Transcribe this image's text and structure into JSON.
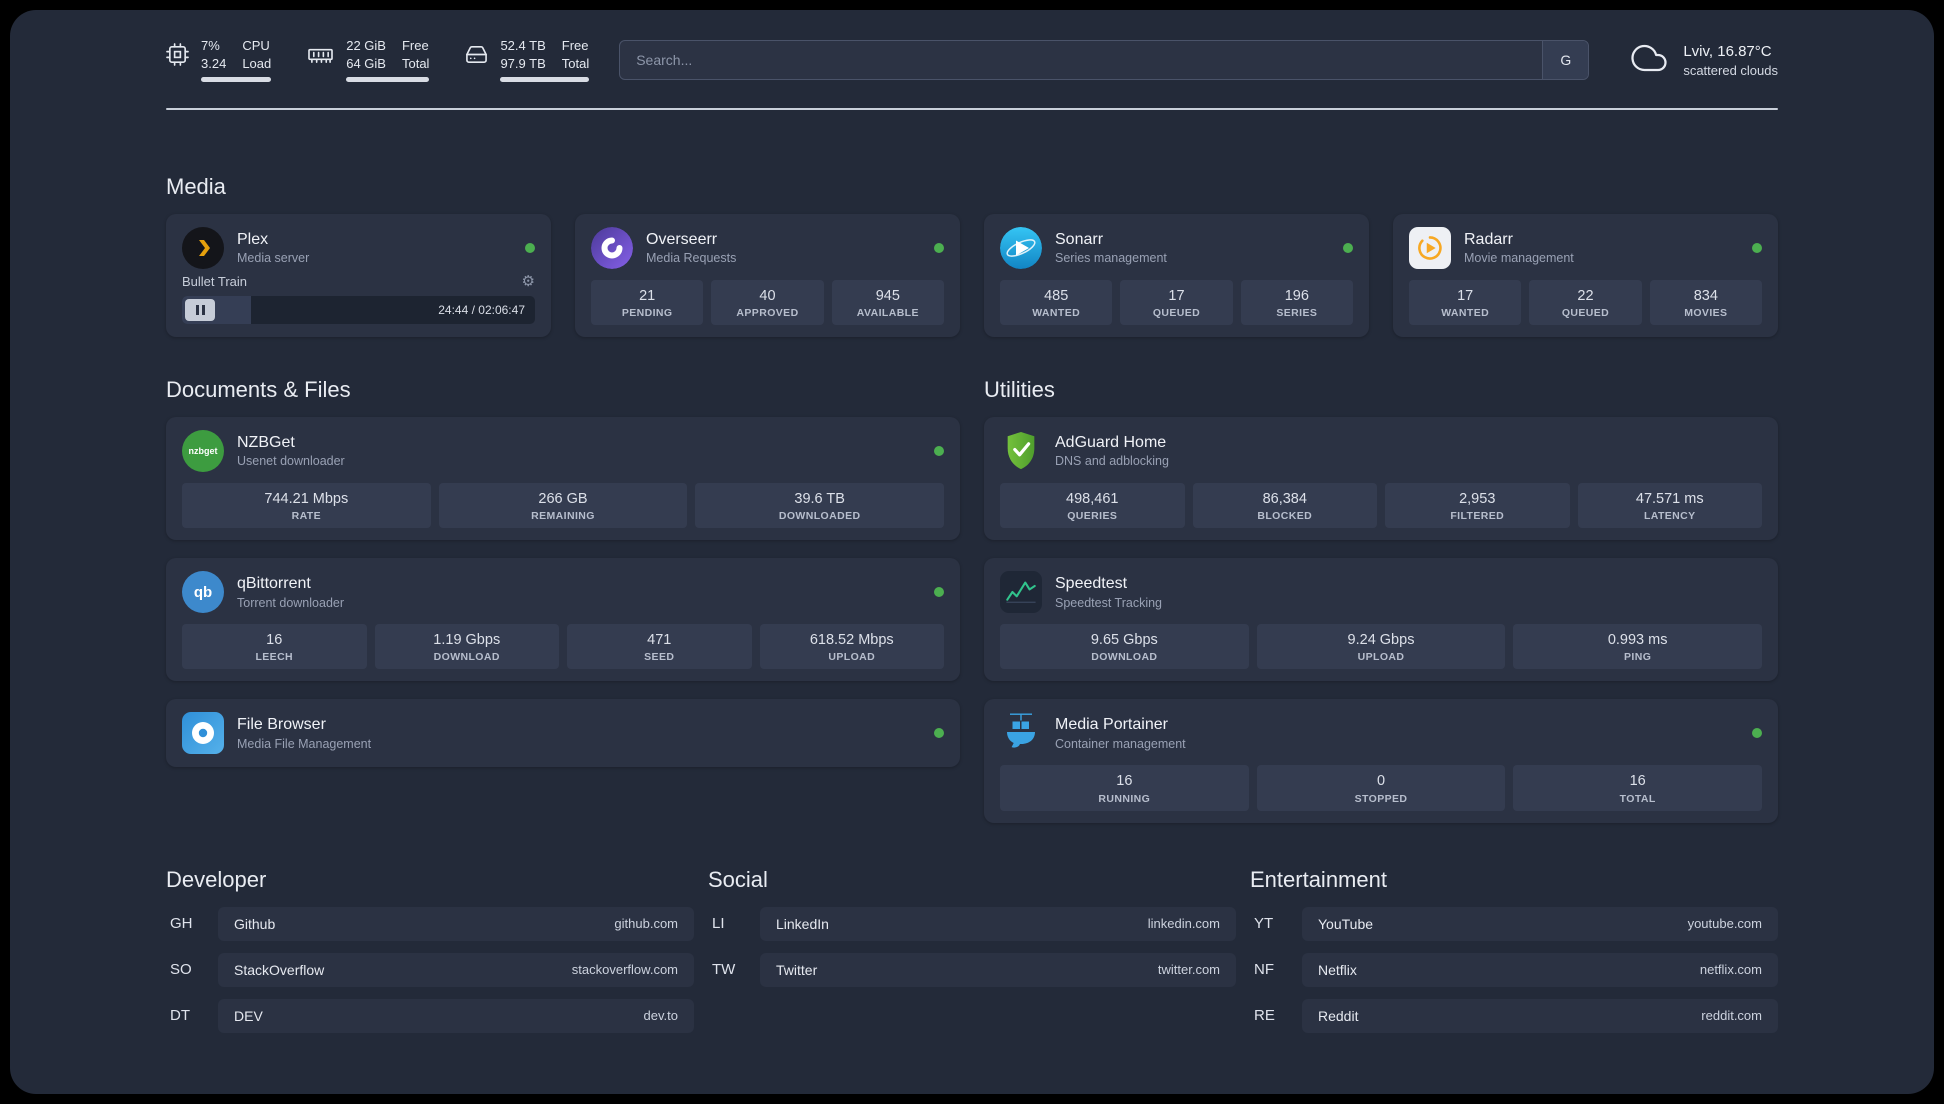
{
  "topbar": {
    "metrics": [
      {
        "icon": "cpu-icon",
        "values": [
          "7%",
          "3.24"
        ],
        "labels": [
          "CPU",
          "Load"
        ]
      },
      {
        "icon": "ram-icon",
        "values": [
          "22 GiB",
          "64 GiB"
        ],
        "labels": [
          "Free",
          "Total"
        ]
      },
      {
        "icon": "disk-icon",
        "values": [
          "52.4 TB",
          "97.9 TB"
        ],
        "labels": [
          "Free",
          "Total"
        ]
      }
    ],
    "search": {
      "placeholder": "Search...",
      "engine_label": "G"
    },
    "weather": {
      "location": "Lviv, 16.87°C",
      "condition": "scattered clouds"
    }
  },
  "media": {
    "title": "Media",
    "cards": [
      {
        "name": "Plex",
        "subtitle": "Media server",
        "online": true,
        "player": {
          "track": "Bullet Train",
          "time": "24:44 / 02:06:47",
          "progress_percent": 19.5
        }
      },
      {
        "name": "Overseerr",
        "subtitle": "Media Requests",
        "online": true,
        "stats": [
          {
            "value": "21",
            "label": "PENDING"
          },
          {
            "value": "40",
            "label": "APPROVED"
          },
          {
            "value": "945",
            "label": "AVAILABLE"
          }
        ]
      },
      {
        "name": "Sonarr",
        "subtitle": "Series management",
        "online": true,
        "stats": [
          {
            "value": "485",
            "label": "WANTED"
          },
          {
            "value": "17",
            "label": "QUEUED"
          },
          {
            "value": "196",
            "label": "SERIES"
          }
        ]
      },
      {
        "name": "Radarr",
        "subtitle": "Movie management",
        "online": true,
        "stats": [
          {
            "value": "17",
            "label": "WANTED"
          },
          {
            "value": "22",
            "label": "QUEUED"
          },
          {
            "value": "834",
            "label": "MOVIES"
          }
        ]
      }
    ]
  },
  "documents": {
    "title": "Documents & Files",
    "cards": [
      {
        "name": "NZBGet",
        "subtitle": "Usenet downloader",
        "online": true,
        "stats": [
          {
            "value": "744.21 Mbps",
            "label": "RATE"
          },
          {
            "value": "266 GB",
            "label": "REMAINING"
          },
          {
            "value": "39.6 TB",
            "label": "DOWNLOADED"
          }
        ]
      },
      {
        "name": "qBittorrent",
        "subtitle": "Torrent downloader",
        "online": true,
        "stats": [
          {
            "value": "16",
            "label": "LEECH"
          },
          {
            "value": "1.19 Gbps",
            "label": "DOWNLOAD"
          },
          {
            "value": "471",
            "label": "SEED"
          },
          {
            "value": "618.52 Mbps",
            "label": "UPLOAD"
          }
        ]
      },
      {
        "name": "File Browser",
        "subtitle": "Media File Management",
        "online": true
      }
    ]
  },
  "utilities": {
    "title": "Utilities",
    "cards": [
      {
        "name": "AdGuard Home",
        "subtitle": "DNS and adblocking",
        "stats": [
          {
            "value": "498,461",
            "label": "QUERIES"
          },
          {
            "value": "86,384",
            "label": "BLOCKED"
          },
          {
            "value": "2,953",
            "label": "FILTERED"
          },
          {
            "value": "47.571 ms",
            "label": "LATENCY"
          }
        ]
      },
      {
        "name": "Speedtest",
        "subtitle": "Speedtest Tracking",
        "stats": [
          {
            "value": "9.65 Gbps",
            "label": "DOWNLOAD"
          },
          {
            "value": "9.24 Gbps",
            "label": "UPLOAD"
          },
          {
            "value": "0.993 ms",
            "label": "PING"
          }
        ]
      },
      {
        "name": "Media Portainer",
        "subtitle": "Container management",
        "online": true,
        "stats": [
          {
            "value": "16",
            "label": "RUNNING"
          },
          {
            "value": "0",
            "label": "STOPPED"
          },
          {
            "value": "16",
            "label": "TOTAL"
          }
        ]
      }
    ]
  },
  "links": {
    "columns": [
      {
        "title": "Developer",
        "items": [
          {
            "abbr": "GH",
            "name": "Github",
            "url": "github.com"
          },
          {
            "abbr": "SO",
            "name": "StackOverflow",
            "url": "stackoverflow.com"
          },
          {
            "abbr": "DT",
            "name": "DEV",
            "url": "dev.to"
          }
        ]
      },
      {
        "title": "Social",
        "items": [
          {
            "abbr": "LI",
            "name": "LinkedIn",
            "url": "linkedin.com"
          },
          {
            "abbr": "TW",
            "name": "Twitter",
            "url": "twitter.com"
          }
        ]
      },
      {
        "title": "Entertainment",
        "items": [
          {
            "abbr": "YT",
            "name": "YouTube",
            "url": "youtube.com"
          },
          {
            "abbr": "NF",
            "name": "Netflix",
            "url": "netflix.com"
          },
          {
            "abbr": "RE",
            "name": "Reddit",
            "url": "reddit.com"
          }
        ]
      }
    ]
  },
  "colors": {
    "online_status": "#4caf50",
    "panel_bg": "#232a39",
    "card_bg": "#2b3243",
    "tile_bg": "#343c50",
    "plex_accent": "#e5a00d"
  }
}
